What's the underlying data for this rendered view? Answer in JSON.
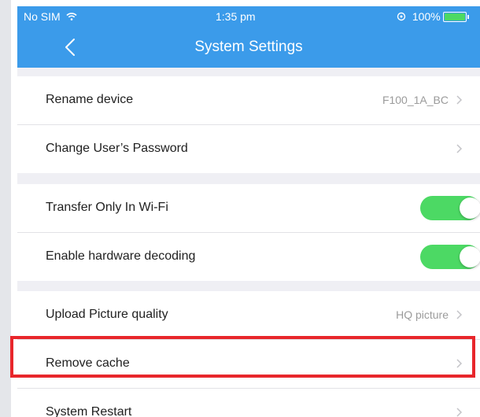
{
  "status_bar": {
    "carrier": "No SIM",
    "time": "1:35 pm",
    "battery": "100%",
    "battery_level": 100
  },
  "header": {
    "title": "System Settings",
    "background_color": "#3b9bea"
  },
  "groups": [
    {
      "rows": [
        {
          "label": "Rename device",
          "value": "F100_1A_BC",
          "type": "disclosure"
        },
        {
          "label": "Change User’s Password",
          "value": "",
          "type": "disclosure"
        }
      ]
    },
    {
      "rows": [
        {
          "label": "Transfer Only In Wi-Fi",
          "type": "toggle",
          "on": true
        },
        {
          "label": "Enable hardware decoding",
          "type": "toggle",
          "on": true
        }
      ]
    },
    {
      "rows": [
        {
          "label": "Upload Picture quality",
          "value": "HQ picture",
          "type": "disclosure"
        },
        {
          "label": "Remove cache",
          "value": "",
          "type": "disclosure",
          "highlighted": true
        },
        {
          "label": "System Restart",
          "value": "",
          "type": "disclosure"
        }
      ]
    }
  ],
  "colors": {
    "toggle_on": "#4cd964",
    "highlight_box": "#e8262b"
  }
}
